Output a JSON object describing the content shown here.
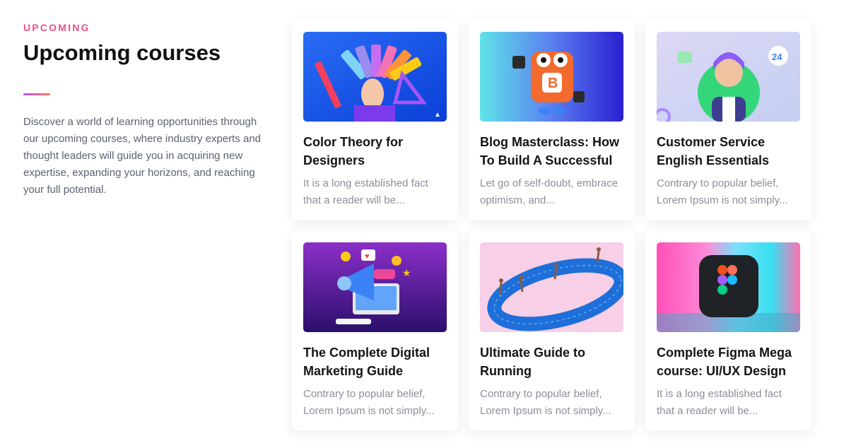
{
  "section": {
    "eyebrow": "UPCOMING",
    "title": "Upcoming courses",
    "description": "Discover a world of learning opportunities through our upcoming courses, where industry experts and thought leaders will guide you in acquiring new expertise, expanding your horizons, and reaching your full potential.",
    "eyebrow_color": "#ec4f8f",
    "accent_gradient": [
      "#b055e8",
      "#ff7a59"
    ]
  },
  "courses": [
    {
      "title": "Color Theory for Designers",
      "excerpt": "It is a long established fact that a reader will be...",
      "image": "color-swatches-illustration"
    },
    {
      "title": "Blog Masterclass: How To Build A Successful",
      "excerpt": "Let go of self-doubt, embrace optimism, and...",
      "image": "blogger-mascot-illustration"
    },
    {
      "title": "Customer Service English Essentials",
      "excerpt": "Contrary to popular belief, Lorem Ipsum is not simply...",
      "image": "support-agent-avatar-illustration"
    },
    {
      "title": "The Complete Digital Marketing Guide",
      "excerpt": "Contrary to popular belief, Lorem Ipsum is not simply...",
      "image": "megaphone-marketing-illustration"
    },
    {
      "title": "Ultimate Guide to Running",
      "excerpt": "Contrary to popular belief, Lorem Ipsum is not simply...",
      "image": "running-track-illustration"
    },
    {
      "title": "Complete Figma Mega course: UI/UX Design",
      "excerpt": "It is a long established fact that a reader will be...",
      "image": "figma-logo-3d-illustration"
    }
  ]
}
